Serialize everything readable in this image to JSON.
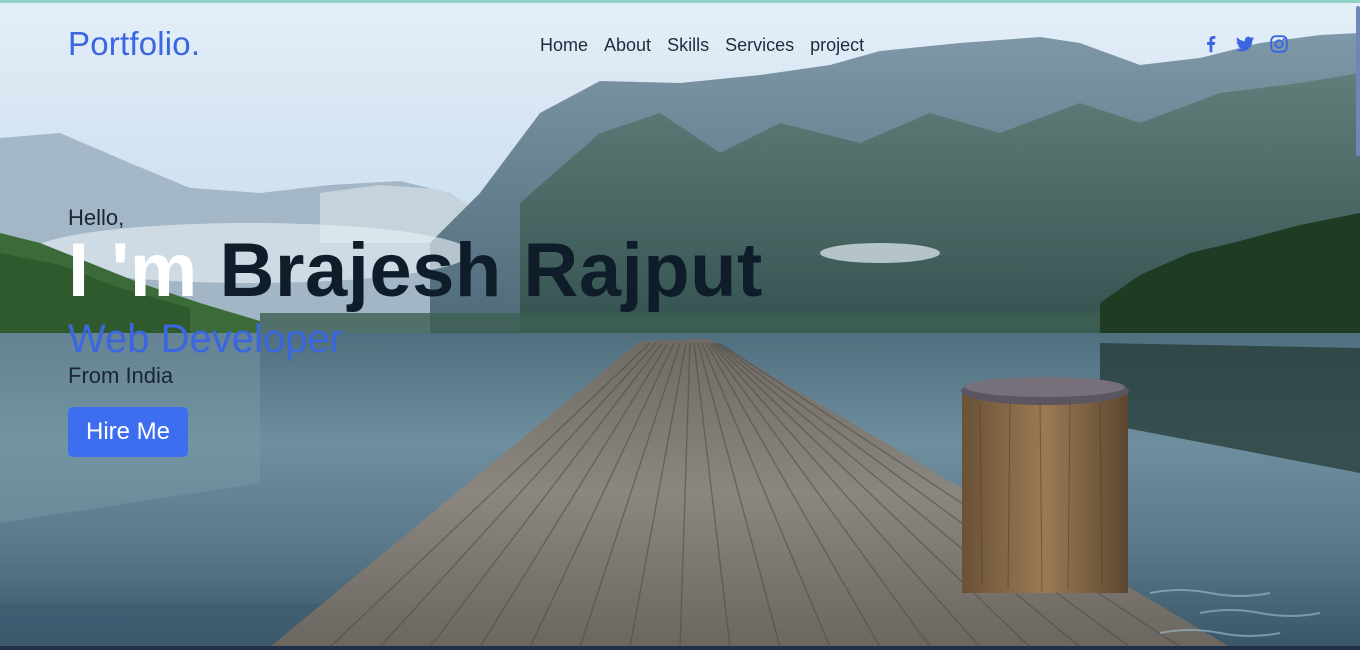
{
  "brand": {
    "logo": "Portfolio."
  },
  "nav": {
    "links": [
      {
        "label": "Home"
      },
      {
        "label": "About"
      },
      {
        "label": "Skills"
      },
      {
        "label": "Services"
      },
      {
        "label": "project"
      }
    ]
  },
  "social": {
    "icons": [
      "facebook-icon",
      "twitter-icon",
      "instagram-icon"
    ]
  },
  "hero": {
    "greeting": "Hello,",
    "name_prefix": "I 'm",
    "name": "Brajesh Rajput",
    "role": "Web Developer",
    "location": "From India",
    "cta_label": "Hire Me"
  },
  "colors": {
    "accent": "#3a67e0",
    "button": "#3d6ef0",
    "heading": "#0f1d2b"
  }
}
